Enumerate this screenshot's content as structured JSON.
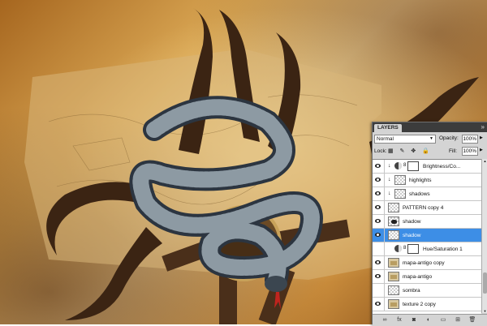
{
  "layers_panel": {
    "tab_label": "LAYERS",
    "close_glyph": "»",
    "blend_mode": "Normal",
    "opacity_label": "Opacity:",
    "opacity_value": "100%",
    "lock_label": "Lock:",
    "fill_label": "Fill:",
    "fill_value": "100%",
    "lock_icons": "▦ ✎ ✥ 🔒",
    "layers": [
      {
        "name": "Brightness/Co...",
        "visible": true,
        "kind": "adjustment",
        "clipped": true
      },
      {
        "name": "highlights",
        "visible": true,
        "kind": "pixel",
        "clipped": true
      },
      {
        "name": "shadows",
        "visible": true,
        "kind": "pixel",
        "clipped": true
      },
      {
        "name": "PATTERN copy 4",
        "visible": true,
        "kind": "pixel",
        "clipped": false
      },
      {
        "name": "shadow",
        "visible": true,
        "kind": "pixel-dark",
        "clipped": false
      },
      {
        "name": "shadow",
        "visible": true,
        "kind": "pixel",
        "clipped": false,
        "selected": true
      },
      {
        "name": "Hue/Saturation 1",
        "visible": false,
        "kind": "adjustment",
        "clipped": false
      },
      {
        "name": "mapa-antigo copy",
        "visible": true,
        "kind": "texture",
        "clipped": false
      },
      {
        "name": "mapa-antigo",
        "visible": true,
        "kind": "texture",
        "clipped": false
      },
      {
        "name": "sombra",
        "visible": false,
        "kind": "pixel",
        "clipped": false
      },
      {
        "name": "texture 2 copy",
        "visible": true,
        "kind": "texture",
        "clipped": false
      }
    ],
    "footer_icons": [
      "link-icon",
      "fx-icon",
      "mask-icon",
      "adjustment-icon",
      "folder-icon",
      "new-layer-icon",
      "trash-icon"
    ],
    "footer_glyphs": [
      "∞",
      "fx",
      "◙",
      "◐",
      "▭",
      "⊞",
      "🗑"
    ]
  },
  "colors": {
    "selection": "#3d8ee6",
    "panel_bg": "#d4d4d4",
    "tab_bar": "#3c3c3c"
  }
}
